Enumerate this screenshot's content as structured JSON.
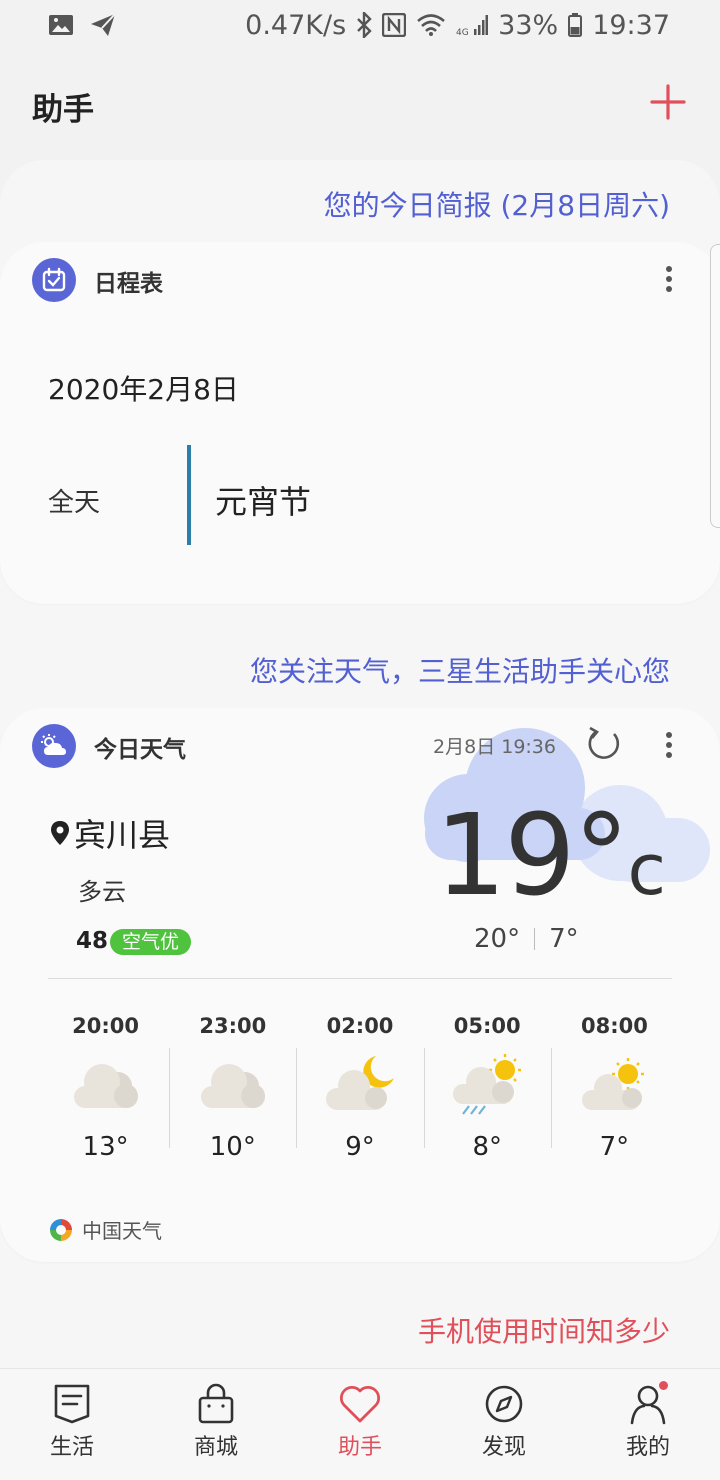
{
  "status_bar": {
    "speed": "0.47K/s",
    "network": "4G",
    "battery": "33%",
    "time": "19:37"
  },
  "header": {
    "title": "助手"
  },
  "sections": {
    "briefing_heading": "您的今日简报 (2月8日周六)",
    "weather_heading": "您关注天气，三星生活助手关心您",
    "usage_heading": "手机使用时间知多少"
  },
  "schedule": {
    "title": "日程表",
    "date": "2020年2月8日",
    "allday_label": "全天",
    "event": "元宵节"
  },
  "weather": {
    "title": "今日天气",
    "updated": "2月8日 19:36",
    "location": "宾川县",
    "condition": "多云",
    "aqi_value": "48",
    "aqi_label": "空气优",
    "temp": "19°",
    "temp_unit": "c",
    "high": "20°",
    "low": "7°",
    "source": "中国天气",
    "hourly": [
      {
        "time": "20:00",
        "temp": "13°",
        "icon": "cloudy-icon"
      },
      {
        "time": "23:00",
        "temp": "10°",
        "icon": "cloudy-icon"
      },
      {
        "time": "02:00",
        "temp": "9°",
        "icon": "cloudy-night-icon"
      },
      {
        "time": "05:00",
        "temp": "8°",
        "icon": "sun-rain-icon"
      },
      {
        "time": "08:00",
        "temp": "7°",
        "icon": "partly-sunny-icon"
      }
    ]
  },
  "bottom_nav": [
    {
      "label": "生活",
      "icon": "life-icon"
    },
    {
      "label": "商城",
      "icon": "shop-bag-icon"
    },
    {
      "label": "助手",
      "icon": "heart-icon",
      "active": true
    },
    {
      "label": "发现",
      "icon": "compass-icon"
    },
    {
      "label": "我的",
      "icon": "profile-icon"
    }
  ],
  "colors": {
    "accent_blue": "#5260d1",
    "accent_red": "#e0505a",
    "aqi_green": "#4fc23e"
  }
}
